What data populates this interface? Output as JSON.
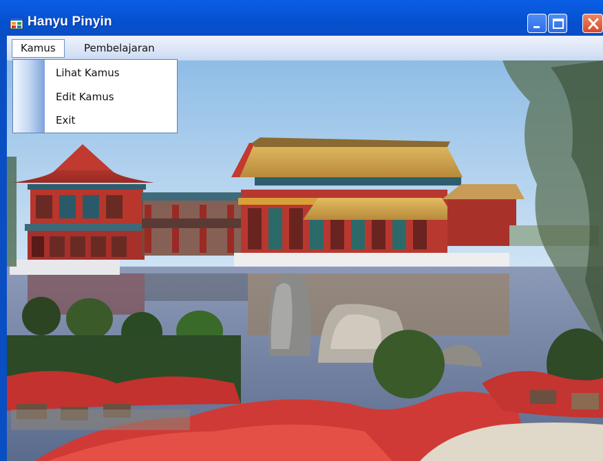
{
  "window": {
    "title": "Hanyu Pinyin",
    "controls": {
      "minimize": "minimize-icon",
      "maximize": "maximize-icon",
      "close": "close-icon"
    }
  },
  "menubar": {
    "items": [
      {
        "label": "Kamus",
        "open": true
      },
      {
        "label": "Pembelajaran",
        "open": false
      }
    ]
  },
  "dropdown": {
    "items": [
      {
        "label": "Lihat Kamus"
      },
      {
        "label": "Edit Kamus"
      },
      {
        "label": "Exit"
      }
    ]
  },
  "scene": {
    "icon": "chinese-pavilion-lake-photo",
    "colors": {
      "sky": "#a6cdec",
      "water": "#7d8aa8",
      "roof": "#d4a650",
      "pillars": "#b8322a",
      "flowers": "#d63a36",
      "foliage": "#3a5a2a"
    }
  }
}
